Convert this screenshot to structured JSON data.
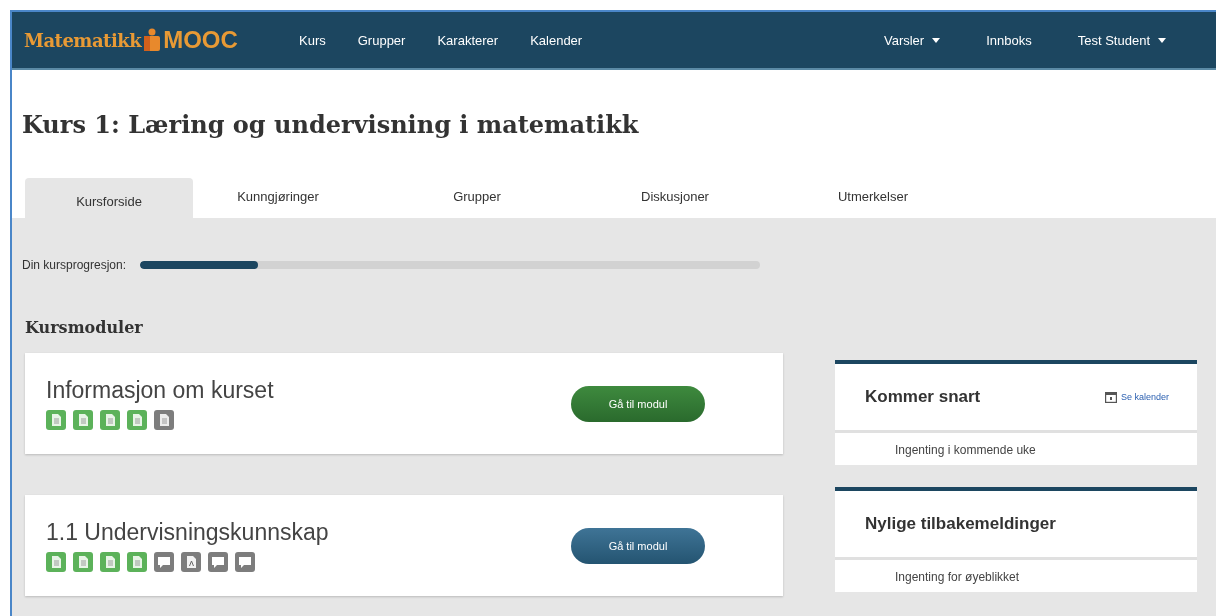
{
  "logo": {
    "text": "Matematikk",
    "accent": "MOOC"
  },
  "nav": {
    "left": [
      "Kurs",
      "Grupper",
      "Karakterer",
      "Kalender"
    ],
    "right": [
      {
        "label": "Varsler",
        "dropdown": true
      },
      {
        "label": "Innboks",
        "dropdown": false
      },
      {
        "label": "Test Student",
        "dropdown": true
      }
    ]
  },
  "title": "Kurs 1: Læring og undervisning i matematikk",
  "tabs": [
    {
      "label": "Kursforside",
      "selected": true
    },
    {
      "label": "Kunngjøringer",
      "selected": false
    },
    {
      "label": "Grupper",
      "selected": false
    },
    {
      "label": "Diskusjoner",
      "selected": false
    },
    {
      "label": "Utmerkelser",
      "selected": false
    }
  ],
  "progress": {
    "label": "Din kursprogresjon:",
    "level": 0.19
  },
  "modules_heading": "Kursmoduler",
  "modules": [
    {
      "title": "Informasjon om kurset",
      "button": "Gå til modul",
      "completed": true,
      "items": [
        {
          "kind": "page",
          "done": true
        },
        {
          "kind": "page",
          "done": true
        },
        {
          "kind": "page",
          "done": true
        },
        {
          "kind": "page",
          "done": true
        },
        {
          "kind": "page",
          "done": false
        }
      ]
    },
    {
      "title": "1.1 Undervisningskunnskap",
      "button": "Gå til modul",
      "completed": false,
      "items": [
        {
          "kind": "page",
          "done": true
        },
        {
          "kind": "page",
          "done": true
        },
        {
          "kind": "page",
          "done": true
        },
        {
          "kind": "page",
          "done": true
        },
        {
          "kind": "discussion",
          "done": false
        },
        {
          "kind": "quiz",
          "done": false
        },
        {
          "kind": "discussion",
          "done": false
        },
        {
          "kind": "discussion",
          "done": false
        }
      ]
    }
  ],
  "side_panels": [
    {
      "title": "Kommer snart",
      "link": "Se kalender",
      "empty_text": "Ingenting i kommende uke"
    },
    {
      "title": "Nylige tilbakemeldinger",
      "empty_text": "Ingenting for øyeblikket"
    }
  ]
}
